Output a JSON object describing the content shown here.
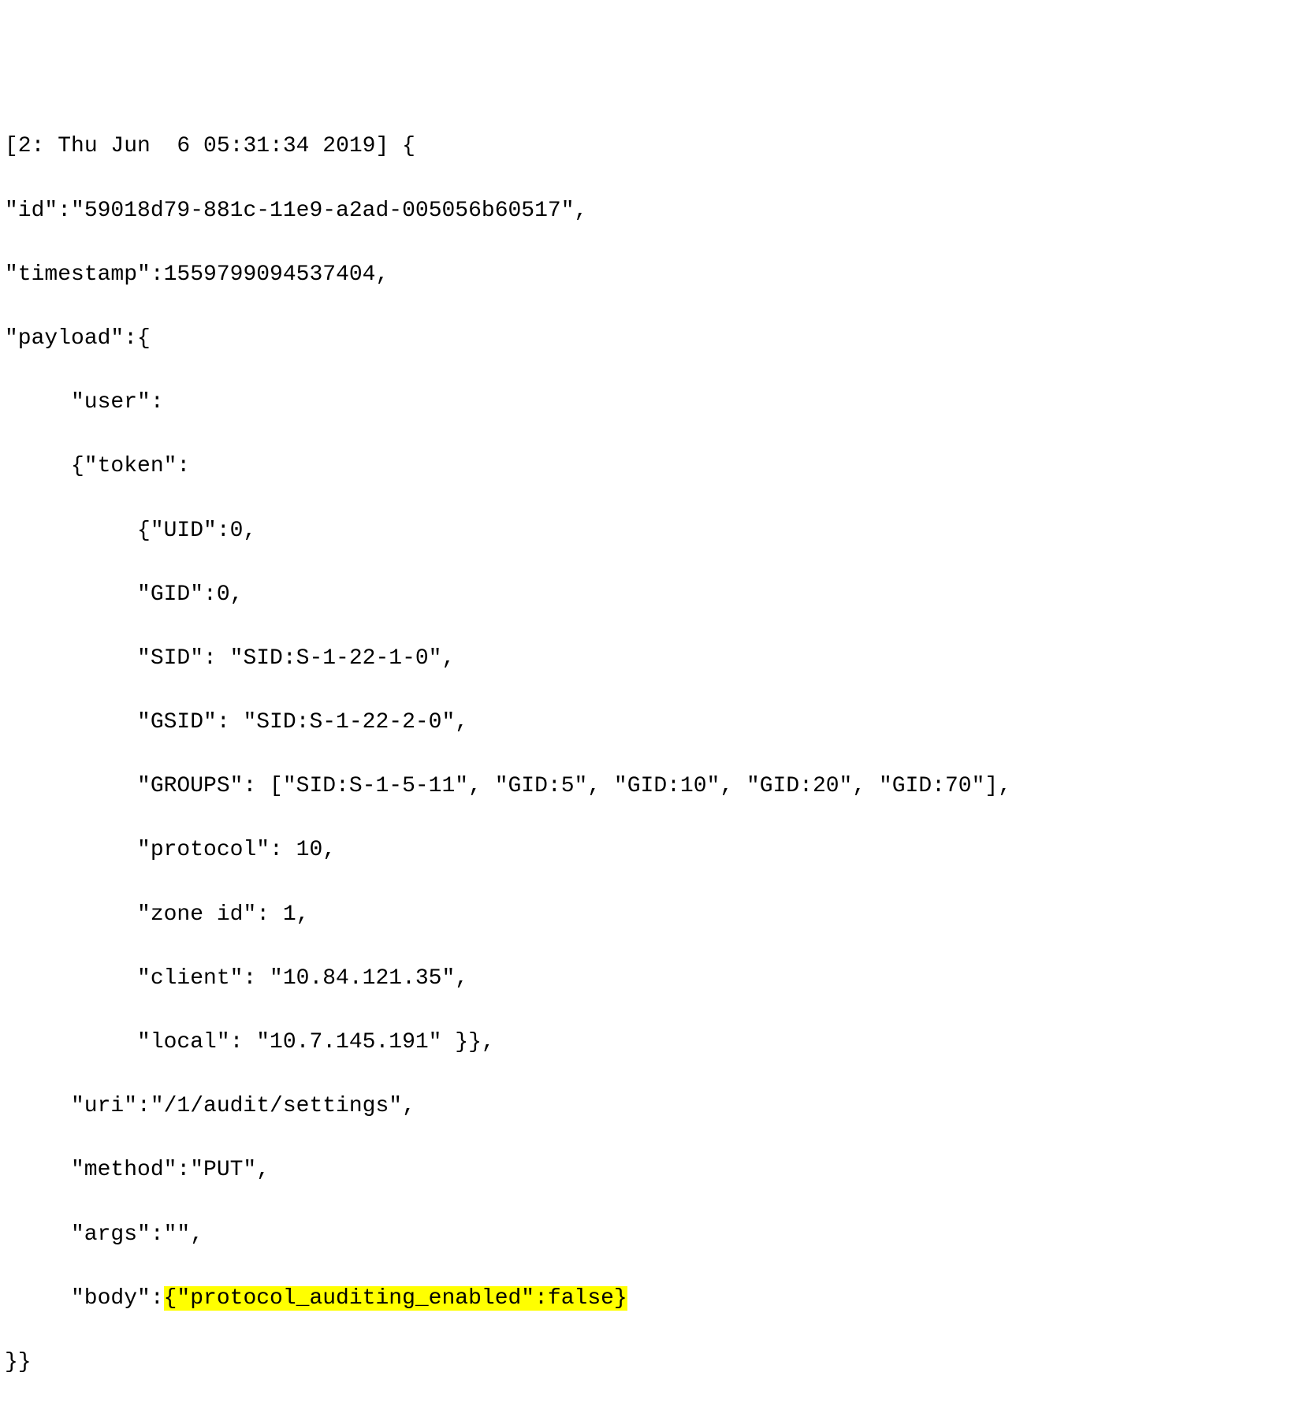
{
  "log": {
    "header": "[2: Thu Jun  6 05:31:34 2019] {",
    "id_line": "\"id\":\"59018d79-881c-11e9-a2ad-005056b60517\",",
    "timestamp_line": "\"timestamp\":1559799094537404,",
    "payload_open": "\"payload\":{",
    "user_line": "\"user\":",
    "token_open": "{\"token\":",
    "uid_line": "{\"UID\":0,",
    "gid_line": "\"GID\":0,",
    "sid_line": "\"SID\": \"SID:S-1-22-1-0\",",
    "gsid_line": "\"GSID\": \"SID:S-1-22-2-0\",",
    "groups_line": "\"GROUPS\": [\"SID:S-1-5-11\", \"GID:5\", \"GID:10\", \"GID:20\", \"GID:70\"],",
    "protocol_line": "\"protocol\": 10,",
    "zoneid_line": "\"zone id\": 1,",
    "client_line": "\"client\": \"10.84.121.35\",",
    "local_line": "\"local\": \"10.7.145.191\" }},",
    "uri_line": "\"uri\":\"/1/audit/settings\",",
    "method_line": "\"method\":\"PUT\",",
    "args_line": "\"args\":\"\",",
    "body_prefix": "\"body\":",
    "body_highlight": "{\"protocol_auditing_enabled\":false}",
    "close_line": "}}"
  }
}
